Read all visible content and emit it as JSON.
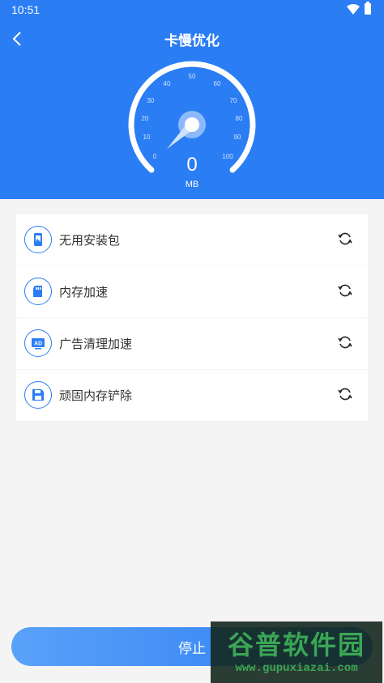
{
  "status_bar": {
    "time": "10:51"
  },
  "header": {
    "title": "卡慢优化"
  },
  "gauge": {
    "value": "0",
    "unit": "MB",
    "ticks": [
      "0",
      "10",
      "20",
      "30",
      "40",
      "50",
      "60",
      "70",
      "80",
      "90",
      "100"
    ]
  },
  "tasks": [
    {
      "label": "无用安装包",
      "icon": "package-icon"
    },
    {
      "label": "内存加速",
      "icon": "sd-card-icon"
    },
    {
      "label": "广告清理加速",
      "icon": "ad-icon"
    },
    {
      "label": "顽固内存铲除",
      "icon": "save-icon"
    }
  ],
  "stop_button": {
    "label": "停止"
  },
  "watermark": {
    "big": "谷普软件园",
    "small": "www.gupuxiazai.com"
  },
  "colors": {
    "primary": "#2a7df3",
    "background": "#f4f4f4"
  }
}
